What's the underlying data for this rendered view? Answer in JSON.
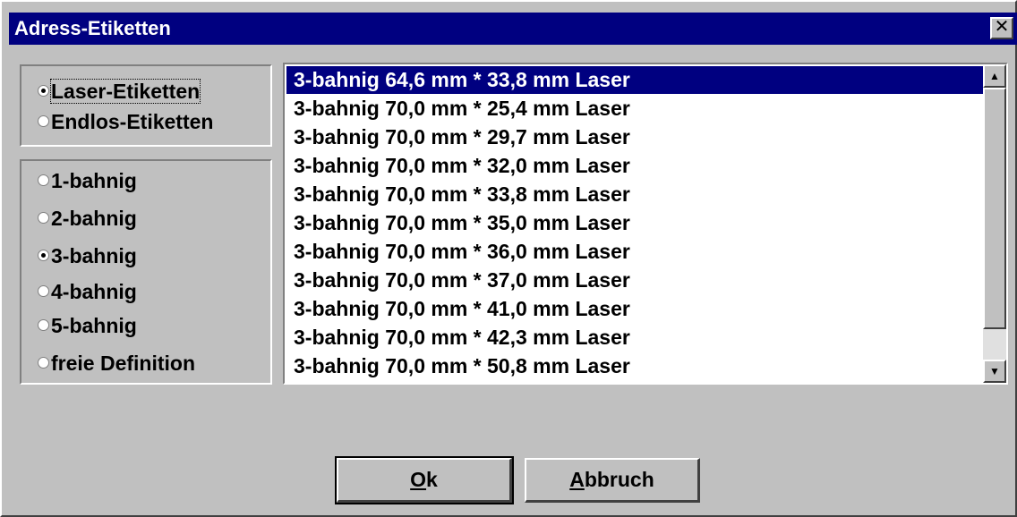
{
  "window": {
    "title": "Adress-Etiketten",
    "close_glyph": "✕"
  },
  "label_type": {
    "options": [
      {
        "label": "Laser-Etiketten",
        "selected": true
      },
      {
        "label": "Endlos-Etiketten",
        "selected": false
      }
    ]
  },
  "columns": {
    "options": [
      {
        "label": "1-bahnig",
        "selected": false
      },
      {
        "label": "2-bahnig",
        "selected": false
      },
      {
        "label": "3-bahnig",
        "selected": true
      },
      {
        "label": "4-bahnig",
        "selected": false
      },
      {
        "label": "5-bahnig",
        "selected": false
      },
      {
        "label": "freie Definition",
        "selected": false
      }
    ]
  },
  "formats": {
    "selected_index": 0,
    "items": [
      "3-bahnig 64,6 mm * 33,8 mm Laser",
      "3-bahnig 70,0 mm * 25,4 mm Laser",
      "3-bahnig 70,0 mm * 29,7 mm Laser",
      "3-bahnig 70,0 mm * 32,0 mm Laser",
      "3-bahnig 70,0 mm * 33,8 mm Laser",
      "3-bahnig 70,0 mm * 35,0 mm Laser",
      "3-bahnig 70,0 mm * 36,0 mm Laser",
      "3-bahnig 70,0 mm * 37,0 mm Laser",
      "3-bahnig 70,0 mm * 41,0 mm Laser",
      "3-bahnig 70,0 mm * 42,3 mm Laser",
      "3-bahnig 70,0 mm * 50,8 mm Laser"
    ]
  },
  "buttons": {
    "ok_mnemonic": "O",
    "ok_rest": "k",
    "cancel_mnemonic": "A",
    "cancel_rest": "bbruch"
  },
  "icons": {
    "scroll_up": "up-arrow-icon",
    "scroll_down": "down-arrow-icon",
    "close": "close-icon"
  },
  "colors": {
    "titlebar": "#000080",
    "face": "#c0c0c0",
    "selection": "#000080"
  }
}
